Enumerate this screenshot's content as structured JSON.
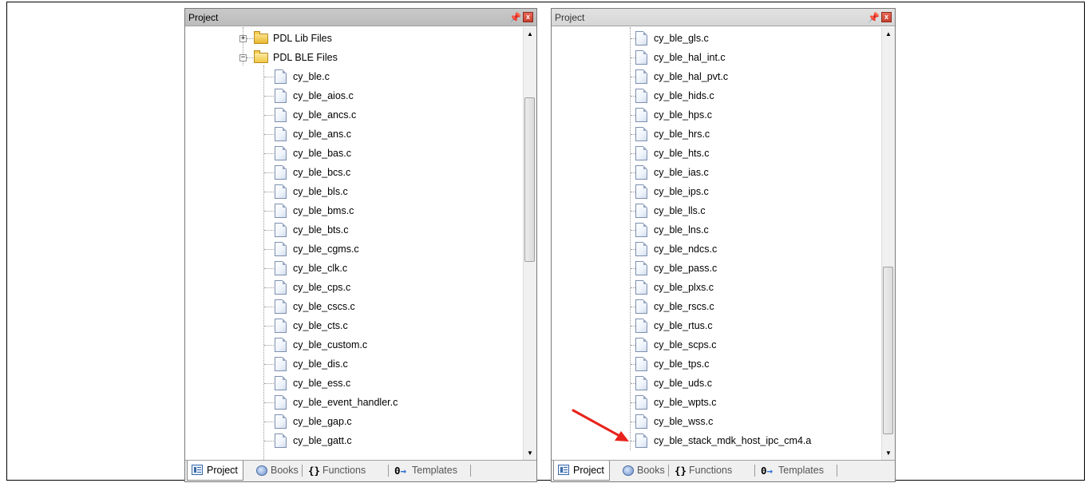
{
  "left_panel": {
    "title": "Project",
    "folders": [
      {
        "label": "PDL Lib Files",
        "expanded": false
      },
      {
        "label": "PDL BLE Files",
        "expanded": true
      }
    ],
    "files": [
      "cy_ble.c",
      "cy_ble_aios.c",
      "cy_ble_ancs.c",
      "cy_ble_ans.c",
      "cy_ble_bas.c",
      "cy_ble_bcs.c",
      "cy_ble_bls.c",
      "cy_ble_bms.c",
      "cy_ble_bts.c",
      "cy_ble_cgms.c",
      "cy_ble_clk.c",
      "cy_ble_cps.c",
      "cy_ble_cscs.c",
      "cy_ble_cts.c",
      "cy_ble_custom.c",
      "cy_ble_dis.c",
      "cy_ble_ess.c",
      "cy_ble_event_handler.c",
      "cy_ble_gap.c",
      "cy_ble_gatt.c"
    ],
    "tabs": [
      "Project",
      "Books",
      "Functions",
      "Templates"
    ]
  },
  "right_panel": {
    "title": "Project",
    "files": [
      "cy_ble_gls.c",
      "cy_ble_hal_int.c",
      "cy_ble_hal_pvt.c",
      "cy_ble_hids.c",
      "cy_ble_hps.c",
      "cy_ble_hrs.c",
      "cy_ble_hts.c",
      "cy_ble_ias.c",
      "cy_ble_ips.c",
      "cy_ble_lls.c",
      "cy_ble_lns.c",
      "cy_ble_ndcs.c",
      "cy_ble_pass.c",
      "cy_ble_plxs.c",
      "cy_ble_rscs.c",
      "cy_ble_rtus.c",
      "cy_ble_scps.c",
      "cy_ble_tps.c",
      "cy_ble_uds.c",
      "cy_ble_wpts.c",
      "cy_ble_wss.c",
      "cy_ble_stack_mdk_host_ipc_cm4.a"
    ],
    "highlighted_file": "cy_ble_stack_mdk_host_ipc_cm4.a",
    "tabs": [
      "Project",
      "Books",
      "Functions",
      "Templates"
    ]
  },
  "icons": {
    "pin": "pin-icon",
    "close": "close-icon",
    "file": "file-icon",
    "folder": "folder-icon",
    "annotation_arrow": "red-arrow-icon"
  },
  "colors": {
    "annotation_arrow": "#e8231c",
    "close_button": "#d04a38"
  }
}
